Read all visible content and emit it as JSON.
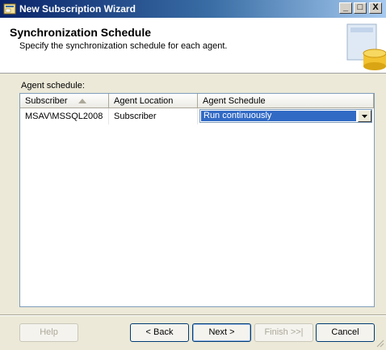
{
  "window": {
    "title": "New Subscription Wizard",
    "controls": {
      "minimize": "_",
      "maximize": "□",
      "close": "X"
    }
  },
  "header": {
    "title": "Synchronization Schedule",
    "subtitle": "Specify the synchronization schedule for each agent.",
    "graphic_icon": "database-schedule-icon"
  },
  "section": {
    "label": "Agent schedule:"
  },
  "grid": {
    "columns": [
      "Subscriber",
      "Agent Location",
      "Agent Schedule"
    ],
    "sort_column": "Subscriber",
    "sort_direction": "ascending",
    "rows": [
      {
        "subscriber": "MSAV\\MSSQL2008",
        "location": "Subscriber",
        "schedule": "Run continuously"
      }
    ]
  },
  "buttons": {
    "help": "Help",
    "back": "< Back",
    "next": "Next >",
    "finish": "Finish >>|",
    "cancel": "Cancel"
  },
  "colors": {
    "selection": "#316ac5",
    "titlebar": "#0a246a",
    "dialog_bg": "#ece9d8"
  }
}
